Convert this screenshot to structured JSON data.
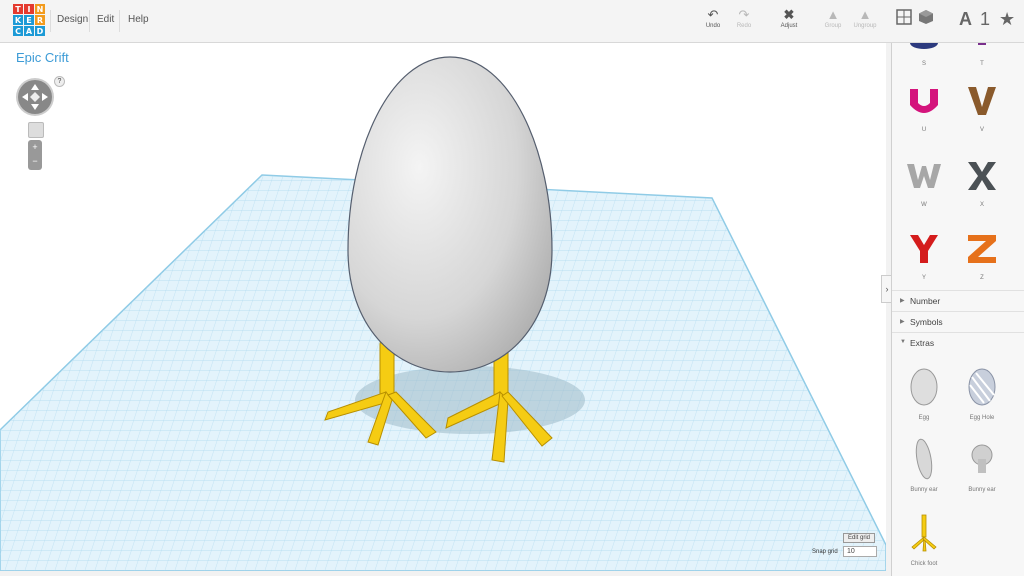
{
  "app": {
    "logo_letters": [
      "T",
      "I",
      "N",
      "K",
      "E",
      "R",
      "C",
      "A",
      "D"
    ],
    "logo_colors": [
      "#e43a2f",
      "#e43a2f",
      "#f29b1d",
      "#1c9ad6",
      "#1c9ad6",
      "#f29b1d",
      "#1c9ad6",
      "#1c9ad6",
      "#1c9ad6"
    ]
  },
  "menu": [
    "Design",
    "Edit",
    "Help"
  ],
  "toolbar": {
    "undo": "Undo",
    "redo": "Redo",
    "adjust": "Adjust",
    "group": "Group",
    "ungroup": "Ungroup"
  },
  "view_icons": {
    "letter": "A",
    "number": "1",
    "star": "★"
  },
  "design_title": "Epic Crift",
  "nav_help": "?",
  "workplane": {
    "edit_grid": "Edit grid",
    "snap_label": "Snap grid",
    "snap_value": "10"
  },
  "panel": {
    "letters": [
      {
        "label": "S",
        "color": "#2c3a7e"
      },
      {
        "label": "T",
        "color": "#7a2f8c"
      },
      {
        "label": "U",
        "color": "#d4147c"
      },
      {
        "label": "V",
        "color": "#8a5a2c"
      },
      {
        "label": "W",
        "color": "#a7a7a7"
      },
      {
        "label": "X",
        "color": "#4b5155"
      },
      {
        "label": "Y",
        "color": "#d41c1c"
      },
      {
        "label": "Z",
        "color": "#e6711b"
      }
    ],
    "sections": [
      "Number",
      "Symbols",
      "Extras"
    ],
    "extras": [
      {
        "label": "Egg"
      },
      {
        "label": "Egg Hole"
      },
      {
        "label": "Bunny ear"
      },
      {
        "label": "Bunny ear"
      },
      {
        "label": "Chick foot"
      }
    ]
  }
}
